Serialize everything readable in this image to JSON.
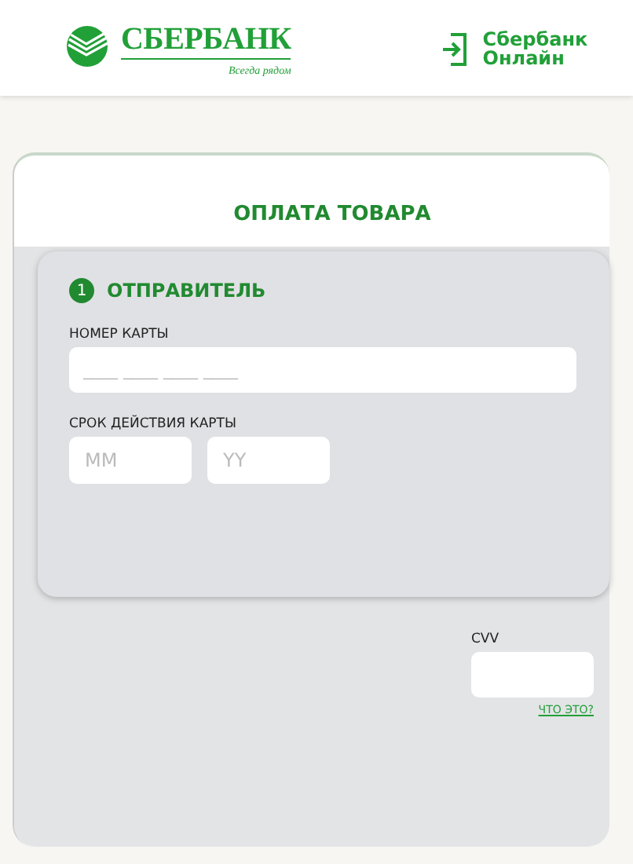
{
  "header": {
    "logo": {
      "name": "СБЕРБАНК",
      "tagline": "Всегда рядом"
    },
    "login_link": {
      "lines": [
        "Сбербанк",
        "Онлайн"
      ]
    }
  },
  "page": {
    "title": "ОПЛАТА ТОВАРА",
    "sender": {
      "step": "1",
      "title": "ОТПРАВИТЕЛЬ",
      "card_number": {
        "label": "НОМЕР КАРТЫ",
        "placeholder": "____ ____ ____ ____"
      },
      "expiry": {
        "label": "СРОК ДЕЙСТВИЯ КАРТЫ",
        "month_placeholder": "MM",
        "year_placeholder": "YY"
      }
    },
    "cvv": {
      "label": "CVV",
      "help_link": "ЧТО ЭТО?"
    }
  }
}
